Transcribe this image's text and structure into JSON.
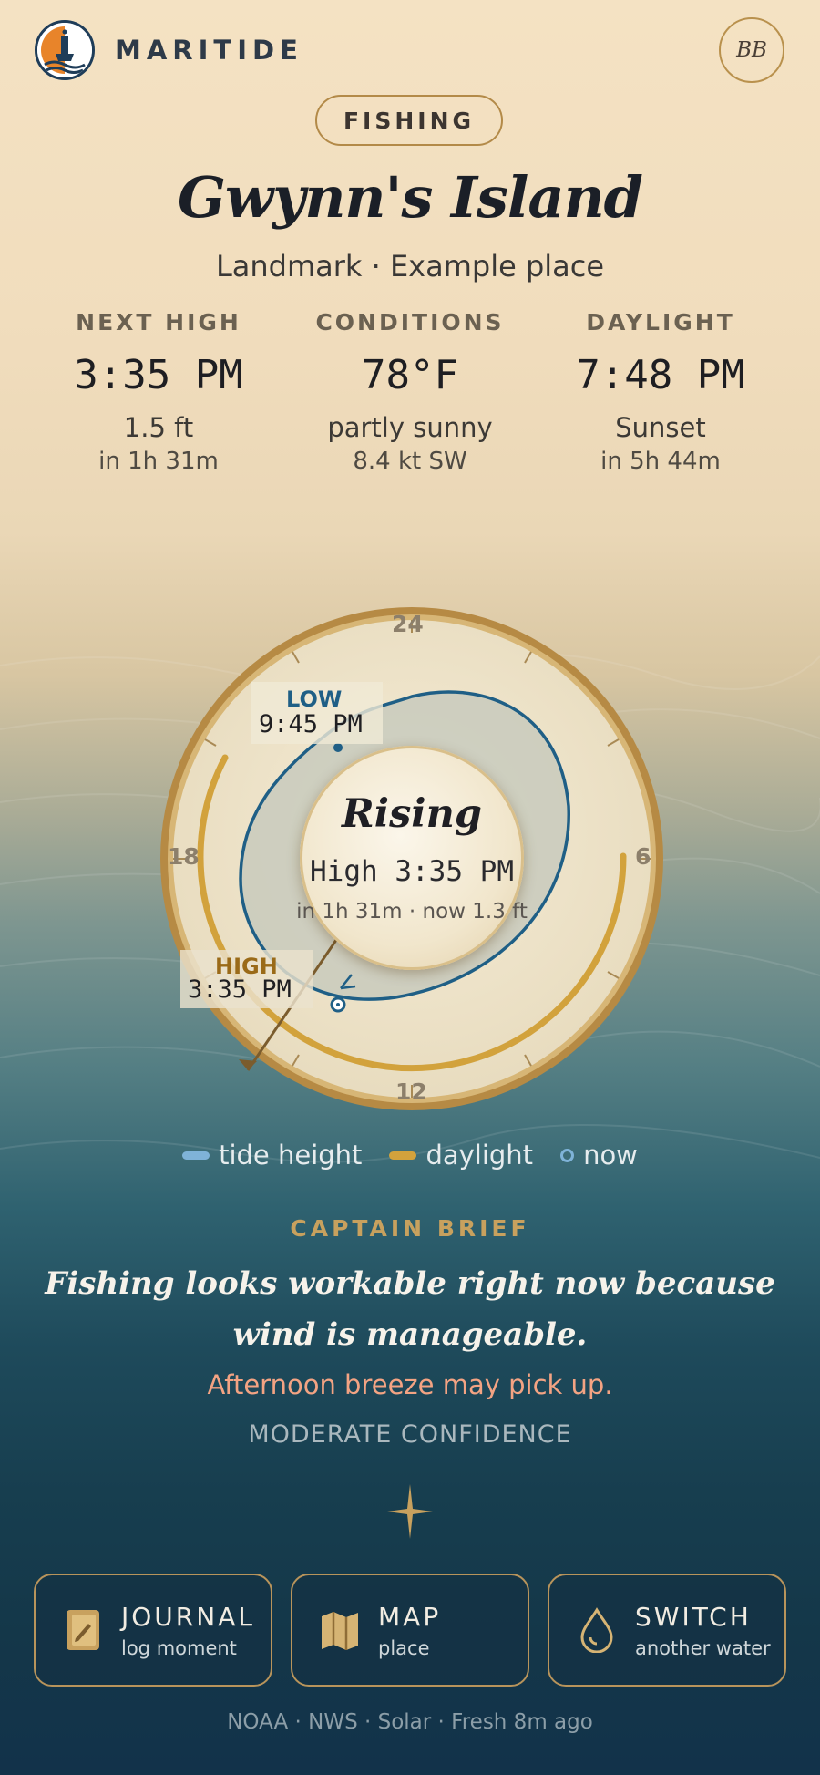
{
  "app": {
    "name": "MARITIDE",
    "avatar_initials": "BB"
  },
  "activity": "FISHING",
  "location": {
    "name": "Gwynn's Island",
    "subtitle": "Landmark · Example place"
  },
  "stats": [
    {
      "label": "NEXT HIGH",
      "value": "3:35 PM",
      "line1": "1.5 ft",
      "line2": "in 1h 31m"
    },
    {
      "label": "CONDITIONS",
      "value": "78°F",
      "line1": "partly sunny",
      "line2": "8.4 kt SW"
    },
    {
      "label": "DAYLIGHT",
      "value": "7:48 PM",
      "line1": "Sunset",
      "line2": "in 5h 44m"
    }
  ],
  "dial": {
    "hours": {
      "top": "24",
      "right": "6",
      "bottom": "12",
      "left": "18"
    },
    "center": {
      "status": "Rising",
      "high": "High 3:35 PM",
      "detail": "in 1h 31m · now 1.3 ft"
    },
    "low_tag": {
      "label": "LOW",
      "time": "9:45 PM"
    },
    "high_tag": {
      "label": "HIGH",
      "time": "3:35 PM"
    },
    "colors": {
      "tide": "#1f5f86",
      "daylight": "#d2a23c",
      "ring": "#c39a4f"
    }
  },
  "legend": [
    {
      "label": "tide height",
      "color": "#7fb3d8"
    },
    {
      "label": "daylight",
      "color": "#d2a23c"
    },
    {
      "label": "now",
      "color": "#7fb3d8"
    }
  ],
  "brief": {
    "label": "CAPTAIN BRIEF",
    "text": "Fishing looks workable right now because wind is manageable.",
    "warning": "Afternoon breeze may pick up.",
    "confidence": "MODERATE CONFIDENCE"
  },
  "actions": [
    {
      "title": "JOURNAL",
      "subtitle": "log moment",
      "icon": "journal-icon"
    },
    {
      "title": "MAP",
      "subtitle": "place",
      "icon": "map-icon"
    },
    {
      "title": "SWITCH",
      "subtitle": "another water",
      "icon": "water-drop-icon"
    }
  ],
  "footer": "NOAA · NWS · Solar · Fresh 8m ago"
}
